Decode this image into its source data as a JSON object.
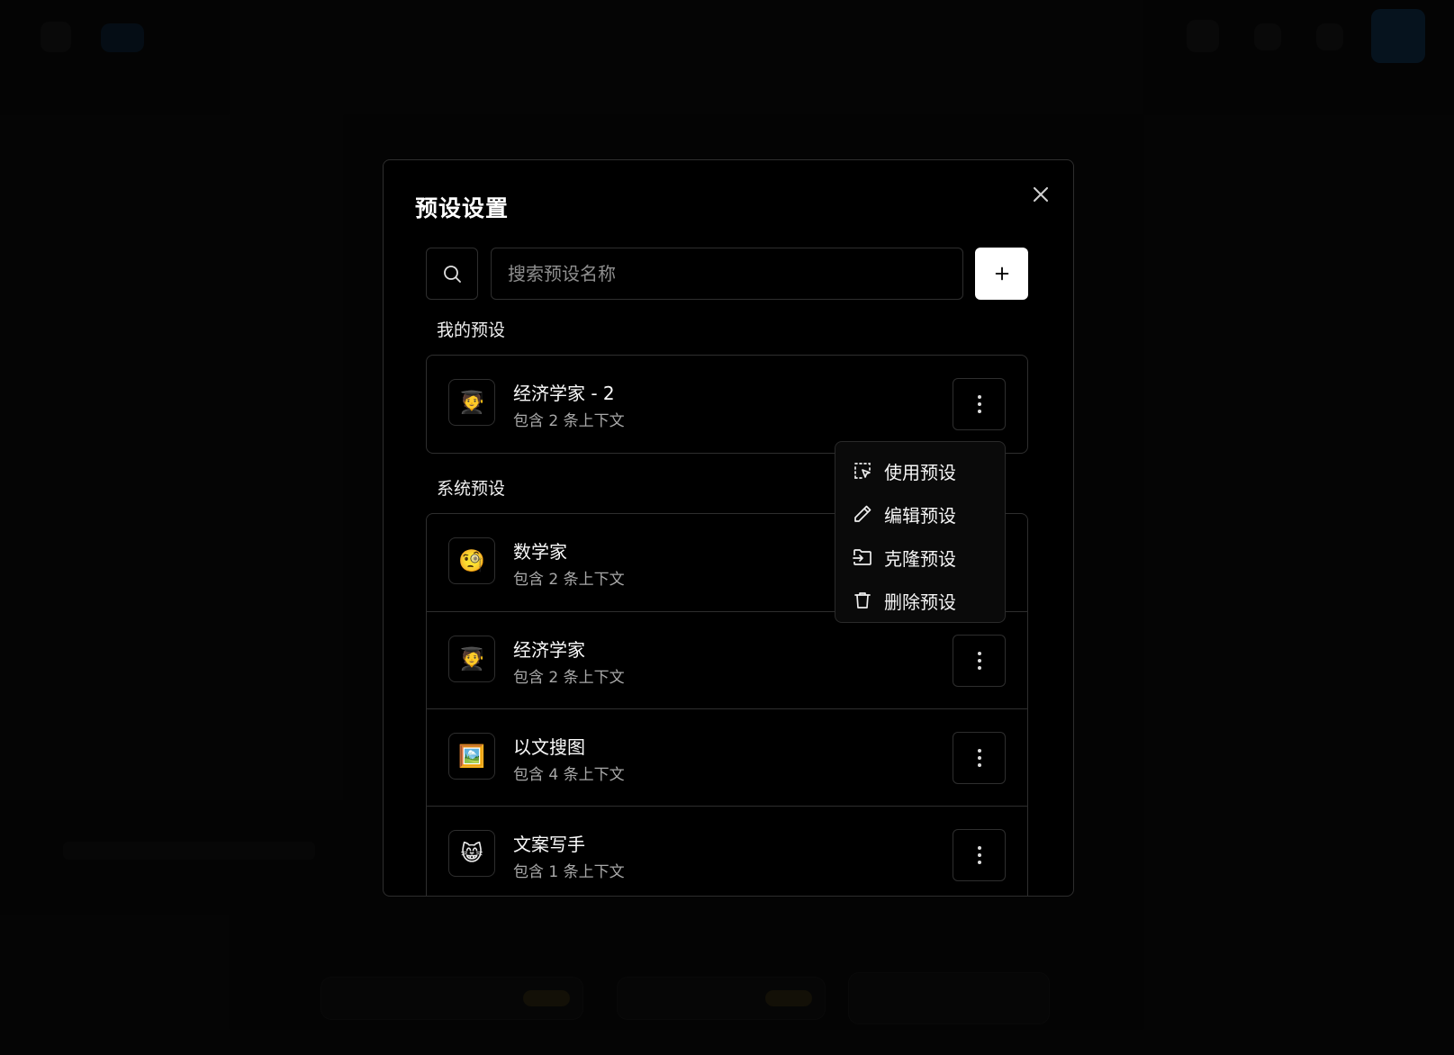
{
  "dialog": {
    "title": "预设设置",
    "search": {
      "placeholder": "搜索预设名称",
      "value": ""
    },
    "sections": {
      "mine_label": "我的预设",
      "system_label": "系统预设"
    },
    "my_presets": [
      {
        "icon": "🧑‍🎓",
        "name": "经济学家 - 2",
        "desc": "包含 2 条上下文"
      }
    ],
    "system_presets": [
      {
        "icon": "🧐",
        "name": "数学家",
        "desc": "包含 2 条上下文"
      },
      {
        "icon": "🧑‍🎓",
        "name": "经济学家",
        "desc": "包含 2 条上下文"
      },
      {
        "icon": "🖼️",
        "name": "以文搜图",
        "desc": "包含 4 条上下文"
      },
      {
        "icon": "😸",
        "name": "文案写手",
        "desc": "包含 1 条上下文"
      }
    ]
  },
  "context_menu": {
    "items": [
      {
        "label": "使用预设",
        "icon": "select-pointer-icon"
      },
      {
        "label": "编辑预设",
        "icon": "pencil-icon"
      },
      {
        "label": "克隆预设",
        "icon": "clone-icon"
      },
      {
        "label": "删除预设",
        "icon": "trash-icon"
      }
    ]
  },
  "colors": {
    "background": "#050505",
    "dialog_bg": "#000000",
    "border": "#2e2e2e",
    "accent_button": "#ffffff"
  }
}
